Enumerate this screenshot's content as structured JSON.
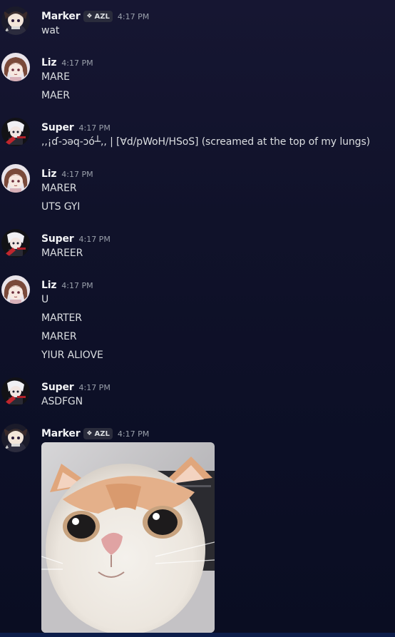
{
  "colors": {
    "background": "#0f1129",
    "username": "#f2f3f5",
    "message_text": "#dbdee1",
    "timestamp": "#9aa0ab",
    "tag_background": "#2a2c3c"
  },
  "messages": [
    {
      "author": "Marker",
      "tag": "AZL",
      "tag_icon": "diamond-badge-icon",
      "time": "4:17 PM",
      "avatar": "marker-avatar",
      "lines": [
        "wat"
      ]
    },
    {
      "author": "Liz",
      "time": "4:17 PM",
      "avatar": "liz-avatar",
      "lines": [
        "MARE",
        "MAER"
      ]
    },
    {
      "author": "Super",
      "time": "4:17 PM",
      "avatar": "super-avatar",
      "lines": [
        ",,¡ɗ-ɔǝq-ɔó┴,, | [ꓯd/pWoH/HSoS] (screamed at the top of my lungs)"
      ]
    },
    {
      "author": "Liz",
      "time": "4:17 PM",
      "avatar": "liz-avatar",
      "lines": [
        "MARER",
        "UTS GYI"
      ]
    },
    {
      "author": "Super",
      "time": "4:17 PM",
      "avatar": "super-avatar",
      "lines": [
        "MAREER"
      ]
    },
    {
      "author": "Liz",
      "time": "4:17 PM",
      "avatar": "liz-avatar",
      "lines": [
        "U",
        "MARTER",
        "MARER",
        "YIUR ALIOVE"
      ]
    },
    {
      "author": "Super",
      "time": "4:17 PM",
      "avatar": "super-avatar",
      "lines": [
        "ASDFGN"
      ]
    },
    {
      "author": "Marker",
      "tag": "AZL",
      "tag_icon": "diamond-badge-icon",
      "time": "4:17 PM",
      "avatar": "marker-avatar",
      "lines": [],
      "attachment": "cat-photo"
    }
  ]
}
